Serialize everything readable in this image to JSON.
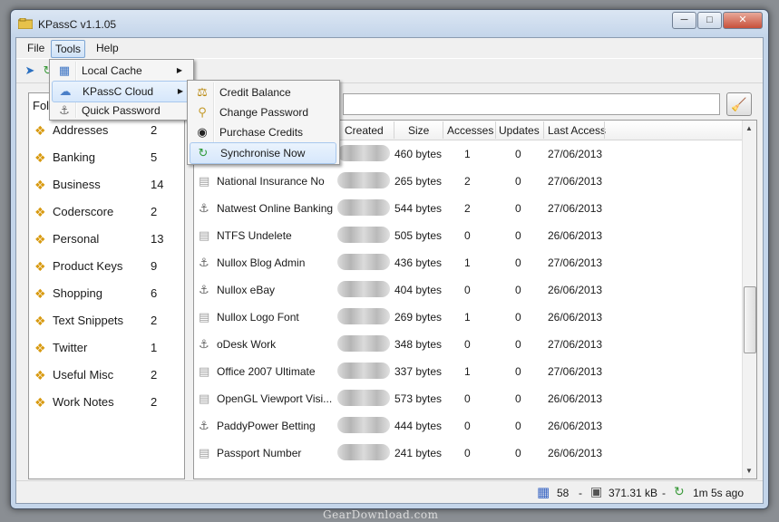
{
  "window": {
    "title": "KPassC v1.1.05"
  },
  "menu": {
    "file": "File",
    "tools": "Tools",
    "help": "Help"
  },
  "tools_menu": [
    {
      "label": "Local Cache",
      "icon": "cache-icon",
      "has_submenu": true
    },
    {
      "label": "KPassC Cloud",
      "icon": "cloud-icon",
      "has_submenu": true
    },
    {
      "label": "Quick Password",
      "icon": "key-icon",
      "has_submenu": false
    }
  ],
  "cloud_menu": [
    {
      "label": "Credit Balance",
      "icon": "scales-icon"
    },
    {
      "label": "Change Password",
      "icon": "keys-icon"
    },
    {
      "label": "Purchase Credits",
      "icon": "credits-icon"
    },
    {
      "label": "Synchronise Now",
      "icon": "sync-icon"
    }
  ],
  "folders": {
    "header": "Fol",
    "items": [
      {
        "name": "Addresses",
        "count": "2"
      },
      {
        "name": "Banking",
        "count": "5"
      },
      {
        "name": "Business",
        "count": "14"
      },
      {
        "name": "Coderscore",
        "count": "2"
      },
      {
        "name": "Personal",
        "count": "13"
      },
      {
        "name": "Product Keys",
        "count": "9"
      },
      {
        "name": "Shopping",
        "count": "6"
      },
      {
        "name": "Text Snippets",
        "count": "2"
      },
      {
        "name": "Twitter",
        "count": "1"
      },
      {
        "name": "Useful Misc",
        "count": "2"
      },
      {
        "name": "Work Notes",
        "count": "2"
      }
    ]
  },
  "grid": {
    "columns": [
      "Created",
      "Size",
      "Accesses",
      "Updates",
      "Last Access"
    ],
    "rows": [
      {
        "name": "",
        "icon": "note-icon",
        "size": "460 bytes",
        "accesses": "1",
        "updates": "0",
        "last": "27/06/2013"
      },
      {
        "name": "National Insurance No",
        "icon": "note-icon",
        "size": "265 bytes",
        "accesses": "2",
        "updates": "0",
        "last": "27/06/2013"
      },
      {
        "name": "Natwest Online Banking",
        "icon": "key-icon",
        "size": "544 bytes",
        "accesses": "2",
        "updates": "0",
        "last": "27/06/2013"
      },
      {
        "name": "NTFS Undelete",
        "icon": "note-icon",
        "size": "505 bytes",
        "accesses": "0",
        "updates": "0",
        "last": "26/06/2013"
      },
      {
        "name": "Nullox Blog Admin",
        "icon": "key-icon",
        "size": "436 bytes",
        "accesses": "1",
        "updates": "0",
        "last": "27/06/2013"
      },
      {
        "name": "Nullox eBay",
        "icon": "key-icon",
        "size": "404 bytes",
        "accesses": "0",
        "updates": "0",
        "last": "26/06/2013"
      },
      {
        "name": "Nullox Logo Font",
        "icon": "note-icon",
        "size": "269 bytes",
        "accesses": "1",
        "updates": "0",
        "last": "26/06/2013"
      },
      {
        "name": "oDesk Work",
        "icon": "key-icon",
        "size": "348 bytes",
        "accesses": "0",
        "updates": "0",
        "last": "27/06/2013"
      },
      {
        "name": "Office 2007 Ultimate",
        "icon": "note-icon",
        "size": "337 bytes",
        "accesses": "1",
        "updates": "0",
        "last": "27/06/2013"
      },
      {
        "name": "OpenGL Viewport Visi...",
        "icon": "note-icon",
        "size": "573 bytes",
        "accesses": "0",
        "updates": "0",
        "last": "26/06/2013"
      },
      {
        "name": "PaddyPower Betting",
        "icon": "key-icon",
        "size": "444 bytes",
        "accesses": "0",
        "updates": "0",
        "last": "26/06/2013"
      },
      {
        "name": "Passport Number",
        "icon": "note-icon",
        "size": "241 bytes",
        "accesses": "0",
        "updates": "0",
        "last": "26/06/2013"
      }
    ]
  },
  "status": {
    "count": "58",
    "sep1": "-",
    "size": "371.31 kB",
    "sep2": "-",
    "sync": "1m 5s ago"
  },
  "watermark": "GearDownload.com"
}
